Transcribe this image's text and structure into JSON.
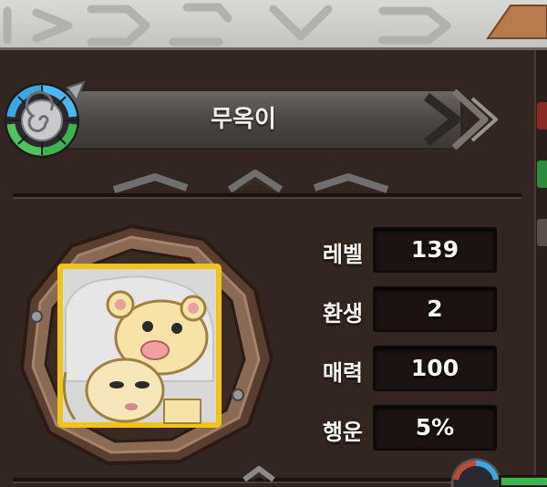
{
  "character": {
    "name": "무옥이"
  },
  "stats": [
    {
      "label": "레벨",
      "value": "139"
    },
    {
      "label": "환생",
      "value": "2"
    },
    {
      "label": "매력",
      "value": "100"
    },
    {
      "label": "행운",
      "value": "5%"
    }
  ],
  "icons": {
    "emblem": "spiral-class-emblem-icon",
    "portrait": "lion-hat-character-portrait",
    "arrow": "double-chevron-right-icon",
    "collapse": "chevron-up-icon"
  },
  "colors": {
    "panel": "#33251f",
    "plate": "#4a4541",
    "stat_box": "#1a1312",
    "frame_wood": "#8a6a55",
    "portrait_border": "#f0c419",
    "emblem_blue": "#3aa7e6",
    "emblem_green": "#3fb34f"
  }
}
